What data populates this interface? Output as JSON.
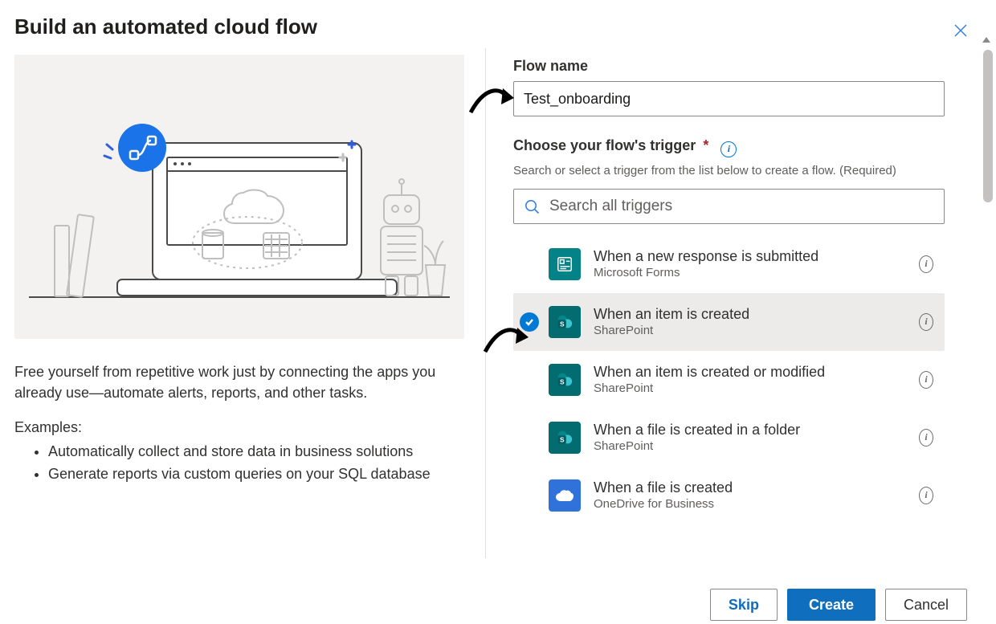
{
  "header": {
    "title": "Build an automated cloud flow"
  },
  "left_panel": {
    "lead": "Free yourself from repetitive work just by connecting the apps you already use—automate alerts, reports, and other tasks.",
    "examples_title": "Examples:",
    "examples": [
      "Automatically collect and store data in business solutions",
      "Generate reports via custom queries on your SQL database"
    ]
  },
  "form": {
    "flow_name_label": "Flow name",
    "flow_name_value": "Test_onboarding",
    "trigger_label": "Choose your flow's trigger",
    "trigger_required_mark": "*",
    "trigger_helper": "Search or select a trigger from the list below to create a flow. (Required)",
    "search_placeholder": "Search all triggers"
  },
  "triggers": [
    {
      "title": "When a new response is submitted",
      "service": "Microsoft Forms",
      "icon": "forms",
      "selected": false
    },
    {
      "title": "When an item is created",
      "service": "SharePoint",
      "icon": "sp",
      "selected": true
    },
    {
      "title": "When an item is created or modified",
      "service": "SharePoint",
      "icon": "sp",
      "selected": false
    },
    {
      "title": "When a file is created in a folder",
      "service": "SharePoint",
      "icon": "sp",
      "selected": false
    },
    {
      "title": "When a file is created",
      "service": "OneDrive for Business",
      "icon": "od",
      "selected": false
    }
  ],
  "footer": {
    "skip": "Skip",
    "create": "Create",
    "cancel": "Cancel"
  }
}
